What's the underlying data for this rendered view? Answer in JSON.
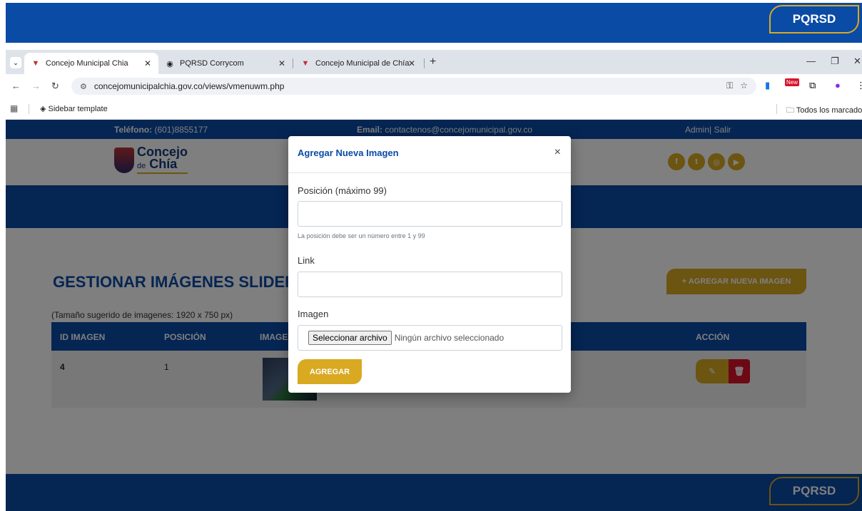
{
  "frame": {
    "pqrsd_label": "PQRSD"
  },
  "browser": {
    "tabs": [
      {
        "label": "Concejo Municipal Chia",
        "active": true
      },
      {
        "label": "PQRSD Corrycom",
        "active": false
      },
      {
        "label": "Concejo Municipal de Chía",
        "active": false
      }
    ],
    "new_tab": "+",
    "url": "concejomunicipalchia.gov.co/views/vmenuwm.php",
    "bookmark_item": "Sidebar template",
    "all_bookmarks": "Todos los marcadores",
    "ext_badge": "New"
  },
  "site": {
    "phone_label": "Teléfono:",
    "phone": "(601)8855177",
    "email_label": "Email:",
    "email": "contactenos@concejomunicipal.gov.co",
    "admin": "Admin",
    "logout": "Salir",
    "logo_top": "Concejo",
    "logo_small": "de",
    "logo_bottom": "Chía",
    "socials": [
      "f",
      "t",
      "◎",
      "▶"
    ]
  },
  "main": {
    "title": "GESTIONAR IMÁGENES SLIDER",
    "add_button": "+ AGREGAR NUEVA IMAGEN",
    "size_hint": "(Tamaño sugerido de imagenes: 1920 x 750 px)",
    "columns": [
      "ID IMAGEN",
      "POSICIÓN",
      "IMAGEN",
      "ACCIÓN"
    ],
    "rows": [
      {
        "id": "4",
        "position": "1"
      }
    ]
  },
  "modal": {
    "title": "Agregar Nueva Imagen",
    "close": "×",
    "position_label": "Posición (máximo 99)",
    "position_value": "",
    "position_help": "La posición debe ser un número entre 1 y 99",
    "link_label": "Link",
    "link_value": "",
    "image_label": "Imagen",
    "file_button": "Seleccionar archivo",
    "file_status": "Ningún archivo seleccionado",
    "submit": "AGREGAR"
  },
  "colors": {
    "primary": "#0a4ba6",
    "accent": "#d9a922",
    "danger": "#d8122a"
  }
}
